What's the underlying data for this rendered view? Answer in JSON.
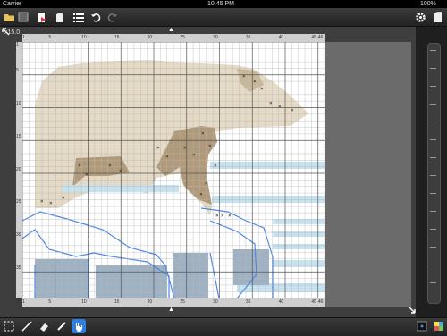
{
  "status_bar": {
    "carrier": "Carrier",
    "time": "10:45 PM",
    "battery": "100%"
  },
  "toolbar": {
    "left_icons": [
      "folder-icon",
      "save-icon",
      "export-icon",
      "bookmark-icon",
      "list-icon",
      "undo-icon",
      "redo-icon"
    ],
    "right_icons": [
      "settings-icon",
      "share-icon"
    ]
  },
  "canvas": {
    "zoom": "x15.0",
    "top_ruler_ticks": [
      "1",
      "5",
      "10",
      "15",
      "20",
      "25",
      "30",
      "35",
      "40",
      "45",
      "46"
    ],
    "bottom_ruler_ticks": [
      "1",
      "5",
      "10",
      "15",
      "20",
      "25",
      "30",
      "35",
      "40",
      "45",
      "46"
    ],
    "left_ruler_ticks": [
      "1",
      "5",
      "10",
      "15",
      "20",
      "25",
      "30",
      "35",
      "40",
      "45"
    ]
  },
  "bottom_toolbar": {
    "tools": [
      "select-tool-icon",
      "needle-tool-icon",
      "eraser-tool-icon",
      "brush-tool-icon",
      "hand-tool-icon"
    ],
    "active_tool": "hand-tool-icon",
    "right_icons": [
      "color-swatch-icon",
      "palette-icon"
    ]
  },
  "colors": {
    "stitch_beige": "#e4dac5",
    "stitch_brown": "#b09a7a",
    "stitch_lightblue": "#c6e2ef",
    "stitch_slate": "#9fb2c4",
    "outline_blue": "#4a86e8",
    "active_tool": "#2d7fe0"
  }
}
